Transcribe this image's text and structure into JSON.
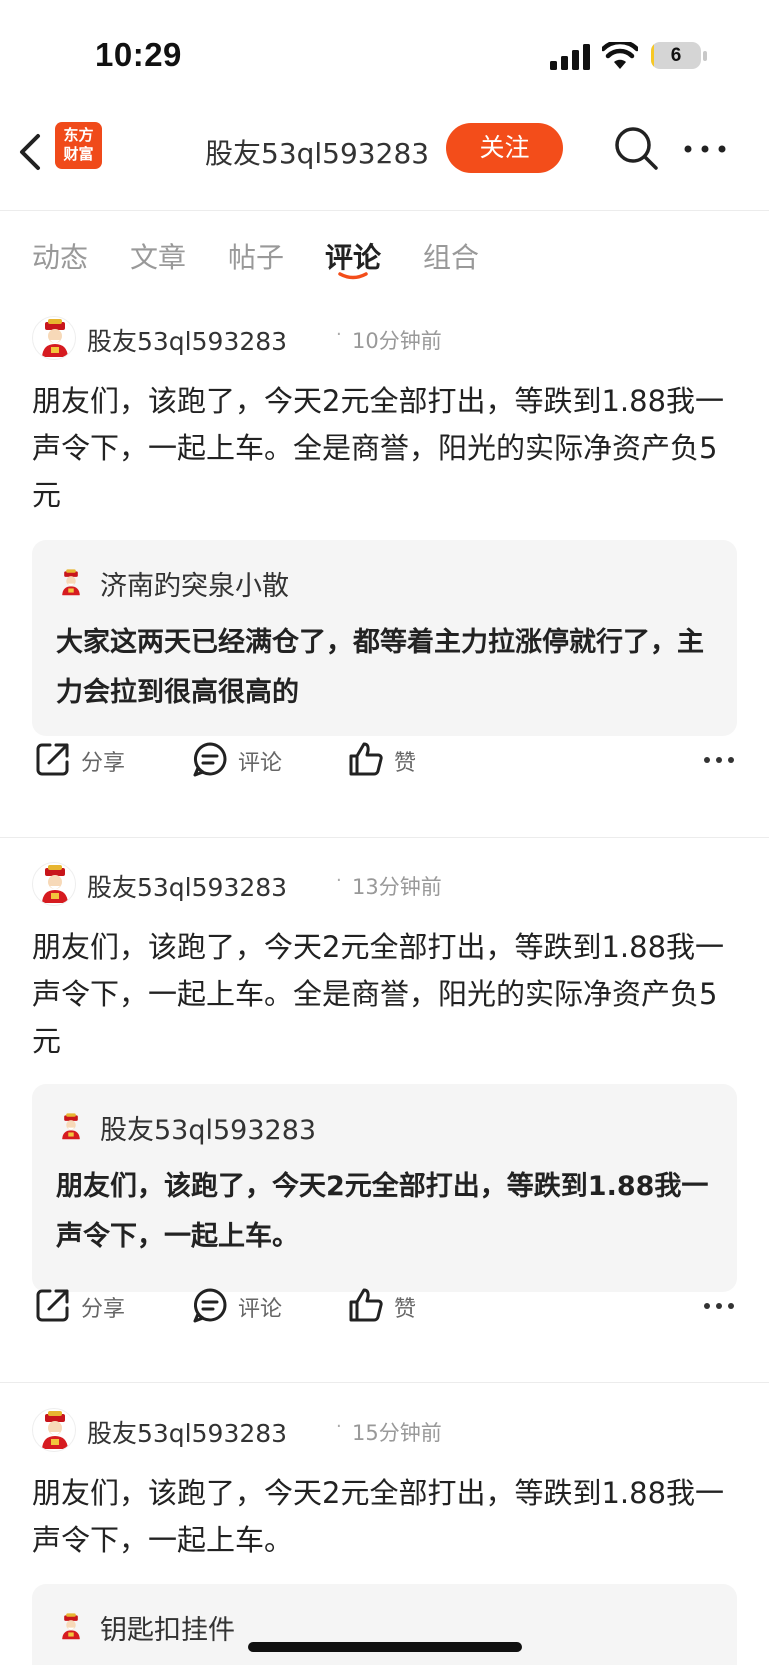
{
  "status_bar": {
    "time": "10:29",
    "battery_level": "6",
    "battery_fraction": 0.06
  },
  "nav": {
    "logo_line1": "东方",
    "logo_line2": "财富",
    "title": "股友53ql593283",
    "follow_label": "关注"
  },
  "tabs": [
    {
      "label": "动态"
    },
    {
      "label": "文章"
    },
    {
      "label": "帖子"
    },
    {
      "label": "评论",
      "active": true
    },
    {
      "label": "组合"
    }
  ],
  "posts": [
    {
      "author": "股友53ql593283",
      "time": "10分钟前",
      "body": "朋友们，该跑了，今天2元全部打出，等跌到1.88我一声令下，一起上车。全是商誉，阳光的实际净资产负5元",
      "quote_author": "济南趵突泉小散",
      "quote_text": "大家这两天已经满仓了，都等着主力拉涨停就行了，主力会拉到很高很高的"
    },
    {
      "author": "股友53ql593283",
      "time": "13分钟前",
      "body": "朋友们，该跑了，今天2元全部打出，等跌到1.88我一声令下，一起上车。全是商誉，阳光的实际净资产负5元",
      "quote_author": "股友53ql593283",
      "quote_text": "朋友们，该跑了，今天2元全部打出，等跌到1.88我一声令下，一起上车。"
    },
    {
      "author": "股友53ql593283",
      "time": "15分钟前",
      "body": "朋友们，该跑了，今天2元全部打出，等跌到1.88我一声令下，一起上车。",
      "quote_author": "钥匙扣挂件"
    }
  ],
  "actions": {
    "share": "分享",
    "comment": "评论",
    "like": "赞"
  },
  "colors": {
    "brand": "#f34d1a",
    "quote_bg": "#f5f5f5",
    "muted": "#999999"
  },
  "icons": {
    "back": "chevron-left-icon",
    "search": "search-icon",
    "more": "more-horizontal-icon",
    "share": "share-icon",
    "comment": "comment-icon",
    "like": "thumbs-up-icon",
    "avatar": "fortune-god-avatar"
  }
}
